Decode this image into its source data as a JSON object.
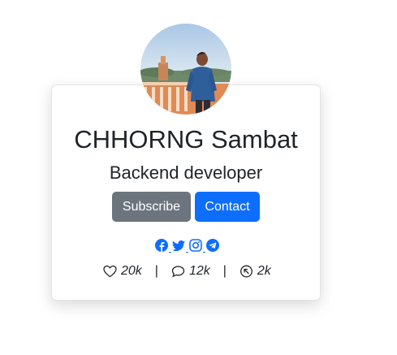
{
  "profile": {
    "name": "CHHORNG Sambat",
    "role": "Backend developer"
  },
  "actions": {
    "subscribe_label": "Subscribe",
    "contact_label": "Contact"
  },
  "socials": [
    {
      "icon": "facebook-icon"
    },
    {
      "icon": "twitter-icon"
    },
    {
      "icon": "instagram-icon"
    },
    {
      "icon": "telegram-icon"
    }
  ],
  "stats": {
    "likes": "20k",
    "comments": "12k",
    "shares": "2k",
    "separator": "|"
  },
  "colors": {
    "primary": "#0d6efd",
    "secondary": "#6c757d",
    "text": "#212529"
  }
}
